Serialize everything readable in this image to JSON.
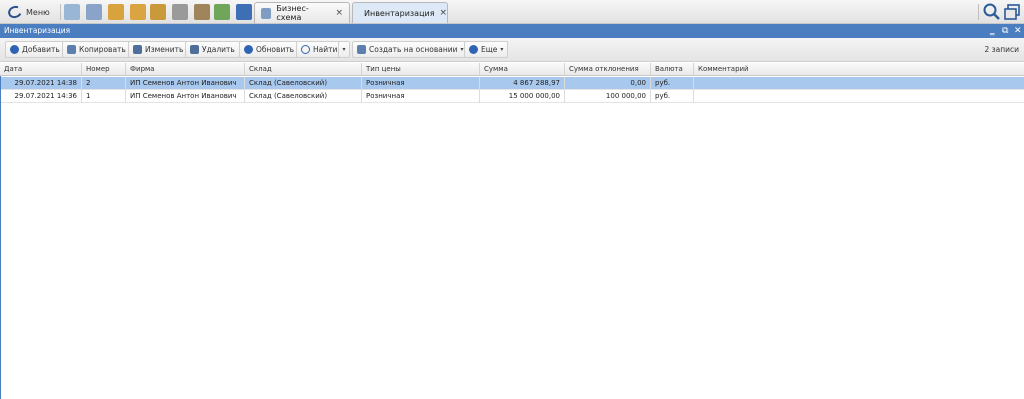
{
  "topbar": {
    "menu_label": "Меню",
    "tabs": [
      {
        "label": "Бизнес-схема",
        "close": "×"
      },
      {
        "label": "Инвентаризация",
        "close": "×"
      }
    ]
  },
  "window": {
    "title": "Инвентаризация",
    "minimize": "‗",
    "restore": "⧉",
    "close": "✕"
  },
  "toolbar": {
    "add_label": "Добавить",
    "copy_label": "Копировать",
    "edit_label": "Изменить",
    "delete_label": "Удалить",
    "refresh_label": "Обновить",
    "find_label": "Найти",
    "create_based_label": "Создать на основании",
    "more_label": "Еще",
    "caret": "▾",
    "record_count": "2 записи"
  },
  "table": {
    "columns": [
      "Дата",
      "Номер",
      "Фирма",
      "Склад",
      "Тип цены",
      "Сумма",
      "Сумма отклонения",
      "Валюта",
      "Комментарий"
    ],
    "rows": [
      [
        "29.07.2021 14:38",
        "2",
        "ИП Семенов Антон Иванович",
        "Склад (Савеловский)",
        "Розничная",
        "4 867 288,97",
        "0,00",
        "руб.",
        ""
      ],
      [
        "29.07.2021 14:36",
        "1",
        "ИП Семенов Антон Иванович",
        "Склад (Савеловский)",
        "Розничная",
        "15 000 000,00",
        "100 000,00",
        "руб.",
        ""
      ]
    ]
  },
  "colors": {
    "accent": "#4a7ec0",
    "selected_row": "#a8c8ee"
  }
}
